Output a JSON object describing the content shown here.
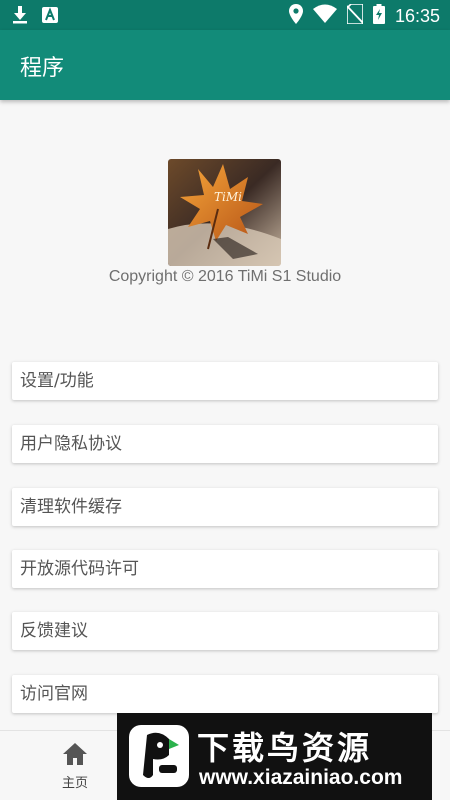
{
  "status_bar": {
    "time": "16:35",
    "icons": [
      "download-icon",
      "a-badge-icon",
      "location-icon",
      "wifi-icon",
      "no-sim-icon",
      "battery-charging-icon"
    ]
  },
  "app_bar": {
    "title": "程序",
    "color": "#128b79"
  },
  "about": {
    "logo_text": "TiMi",
    "copyright": "Copyright © 2016 TiMi S1 Studio"
  },
  "menu": {
    "items": [
      {
        "label": "设置/功能"
      },
      {
        "label": "用户隐私协议"
      },
      {
        "label": "清理软件缓存"
      },
      {
        "label": "开放源代码许可"
      },
      {
        "label": "反馈建议"
      },
      {
        "label": "访问官网"
      }
    ]
  },
  "bottom_nav": {
    "home_label": "主页",
    "home_icon": "home-icon"
  },
  "watermark": {
    "title": "下载鸟资源",
    "url": "www.xiazainiao.com"
  }
}
